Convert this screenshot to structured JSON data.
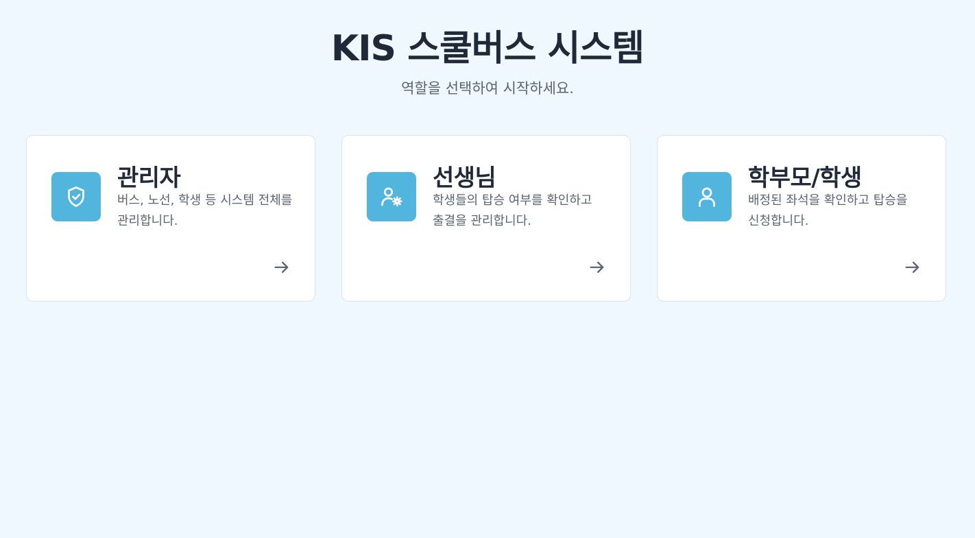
{
  "header": {
    "title": "KIS 스쿨버스 시스템",
    "subtitle": "역할을 선택하여 시작하세요."
  },
  "roles": [
    {
      "title": "관리자",
      "description": "버스, 노선, 학생 등 시스템 전체를 관리합니다.",
      "icon": "shield-check-icon"
    },
    {
      "title": "선생님",
      "description": "학생들의 탑승 여부를 확인하고 출결을 관리합니다.",
      "icon": "user-gear-icon"
    },
    {
      "title": "학부모/학생",
      "description": "배정된 좌석을 확인하고 탑승을 신청합니다.",
      "icon": "user-icon"
    }
  ],
  "colors": {
    "background": "#eff7ff",
    "icon_accent": "#52b5de",
    "title_text": "#1f2937",
    "body_text": "#5b6472",
    "arrow": "#5b6472"
  }
}
